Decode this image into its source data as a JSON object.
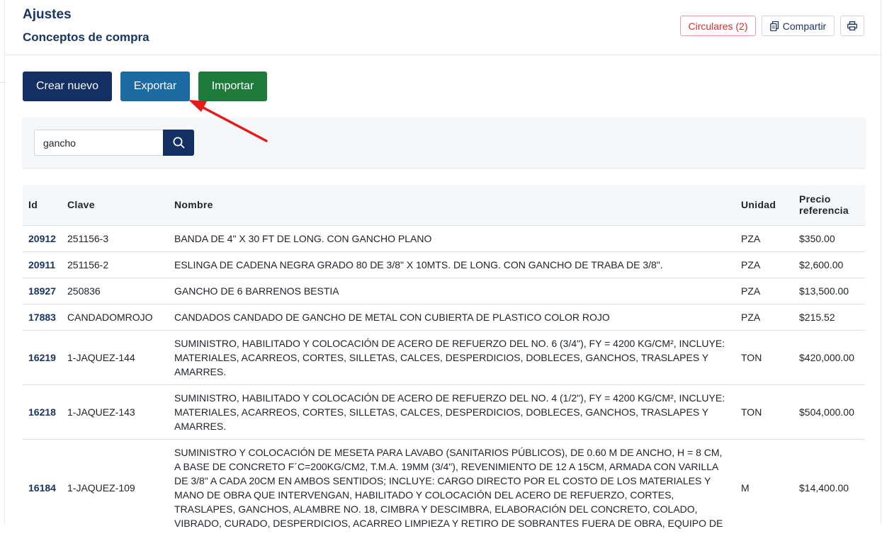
{
  "header": {
    "title": "Ajustes",
    "subtitle": "Conceptos de compra",
    "circulares_label": "Circulares (2)",
    "compartir_label": "Compartir"
  },
  "actions": {
    "crear_label": "Crear nuevo",
    "exportar_label": "Exportar",
    "importar_label": "Importar"
  },
  "search": {
    "value": "gancho"
  },
  "table": {
    "headers": {
      "id": "Id",
      "clave": "Clave",
      "nombre": "Nombre",
      "unidad": "Unidad",
      "precio": "Precio referencia"
    },
    "rows": [
      {
        "id": "20912",
        "clave": "251156-3",
        "nombre": "BANDA DE 4\" X 30 FT DE LONG. CON GANCHO PLANO",
        "unidad": "PZA",
        "precio": "$350.00"
      },
      {
        "id": "20911",
        "clave": "251156-2",
        "nombre": "ESLINGA DE CADENA NEGRA GRADO 80 DE 3/8\" X 10MTS. DE LONG. CON GANCHO DE TRABA DE 3/8\".",
        "unidad": "PZA",
        "precio": "$2,600.00"
      },
      {
        "id": "18927",
        "clave": "250836",
        "nombre": "GANCHO DE 6 BARRENOS BESTIA",
        "unidad": "PZA",
        "precio": "$13,500.00"
      },
      {
        "id": "17883",
        "clave": "CANDADOMROJO",
        "nombre": "CANDADOS CANDADO DE GANCHO DE METAL CON CUBIERTA DE PLASTICO COLOR ROJO",
        "unidad": "PZA",
        "precio": "$215.52"
      },
      {
        "id": "16219",
        "clave": "1-JAQUEZ-144",
        "nombre": "SUMINISTRO, HABILITADO Y COLOCACIÓN DE ACERO DE REFUERZO DEL NO. 6 (3/4\"), FY = 4200 KG/CM², INCLUYE: MATERIALES, ACARREOS, CORTES, SILLETAS, CALCES, DESPERDICIOS, DOBLECES, GANCHOS, TRASLAPES Y AMARRES.",
        "unidad": "TON",
        "precio": "$420,000.00"
      },
      {
        "id": "16218",
        "clave": "1-JAQUEZ-143",
        "nombre": "SUMINISTRO, HABILITADO Y COLOCACIÓN DE ACERO DE REFUERZO DEL NO. 4 (1/2\"), FY = 4200 KG/CM², INCLUYE: MATERIALES, ACARREOS, CORTES, SILLETAS, CALCES, DESPERDICIOS, DOBLECES, GANCHOS, TRASLAPES Y AMARRES.",
        "unidad": "TON",
        "precio": "$504,000.00"
      },
      {
        "id": "16184",
        "clave": "1-JAQUEZ-109",
        "nombre": "SUMINISTRO Y COLOCACIÓN DE MESETA PARA LAVABO (SANITARIOS PÚBLICOS), DE 0.60 M DE ANCHO, H = 8 CM, A BASE DE CONCRETO F´C=200KG/CM2, T.M.A. 19MM (3/4\"), REVENIMIENTO DE 12 A 15CM, ARMADA CON VARILLA DE 3/8\" A CADA 20CM EN AMBOS SENTIDOS; INCLUYE: CARGO DIRECTO POR EL COSTO DE LOS MATERIALES Y MANO DE OBRA QUE INTERVENGAN, HABILITADO Y COLOCACIÓN DEL ACERO DE REFUERZO, CORTES, TRASLAPES, GANCHOS, ALAMBRE NO. 18, CIMBRA Y DESCIMBRA, ELABORACIÓN DEL CONCRETO, COLADO, VIBRADO, CURADO, DESPERDICIOS, ACARREO LIMPIEZA Y RETIRO DE SOBRANTES FUERA DE OBRA, EQUIPO DE",
        "unidad": "M",
        "precio": "$14,400.00"
      }
    ]
  },
  "colors": {
    "primary": "#132f64",
    "export": "#1b6aa1",
    "import": "#1d7a3a",
    "danger": "#d62d2d",
    "annotation_arrow": "#e8191a"
  },
  "icons": {
    "share": "copy-icon",
    "print": "printer-icon",
    "search": "search-icon"
  }
}
